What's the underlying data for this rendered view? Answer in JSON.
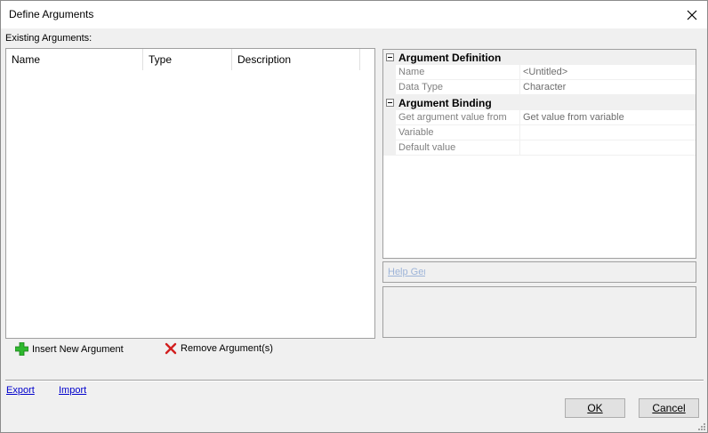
{
  "window": {
    "title": "Define Arguments"
  },
  "existing": {
    "label": "Existing Arguments:",
    "columns": [
      "Name",
      "Type",
      "Description"
    ]
  },
  "actions": {
    "insert_label": "Insert New Argument",
    "remove_label": "Remove Argument(s)"
  },
  "properties": {
    "categories": [
      {
        "label": "Argument Definition",
        "rows": [
          {
            "name": "Name",
            "value": "<Untitled>"
          },
          {
            "name": "Data Type",
            "value": "Character"
          }
        ]
      },
      {
        "label": "Argument Binding",
        "rows": [
          {
            "name": "Get argument value from",
            "value": "Get value from variable"
          },
          {
            "name": "Variable",
            "value": ""
          },
          {
            "name": "Default value",
            "value": ""
          }
        ]
      }
    ],
    "help_link": "Help Generator"
  },
  "footer": {
    "export_label": "Export",
    "import_label": "Import",
    "ok_label": "OK",
    "cancel_label": "Cancel"
  },
  "colors": {
    "insert_icon": "#2eb82e",
    "remove_icon": "#d21f1f",
    "link": "#0000cc"
  },
  "icons": [
    "close-icon",
    "plus-icon",
    "x-icon",
    "collapse-icon",
    "resize-grip-icon"
  ]
}
